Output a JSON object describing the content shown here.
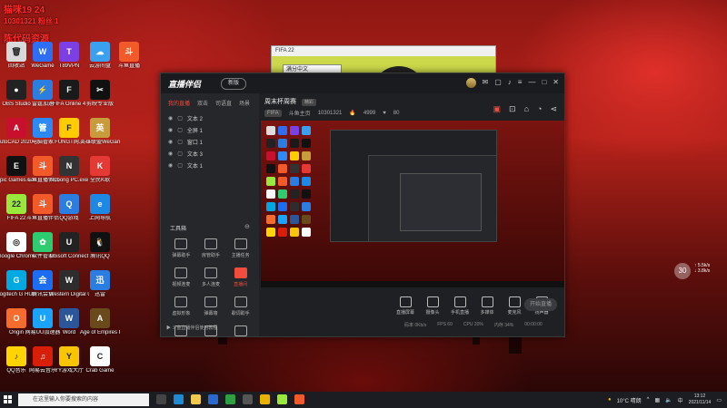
{
  "overlay": {
    "line1": "猫咪19 24",
    "line2": "10301321 粉丝 1",
    "line3": "陈代码资源"
  },
  "desktop_icons": [
    {
      "label": "回收站",
      "color": "#d9d9d9",
      "glyph": "🗑"
    },
    {
      "label": "WeGame",
      "color": "#2e6ef5",
      "glyph": "W"
    },
    {
      "label": "T89VPN",
      "color": "#7b3fe4",
      "glyph": "T"
    },
    {
      "label": "云游间盘",
      "color": "#3aa0f0",
      "glyph": "☁"
    },
    {
      "label": "斗鱼直播",
      "color": "#f25a2a",
      "glyph": "斗"
    },
    {
      "label": "OBS Studio",
      "color": "#222",
      "glyph": "●"
    },
    {
      "label": "雷霆加速",
      "color": "#2a7de1",
      "glyph": "⚡"
    },
    {
      "label": "FIFA Online 4",
      "color": "#1a1a1a",
      "glyph": "F"
    },
    {
      "label": "剪映专业版",
      "color": "#111",
      "glyph": "✂"
    },
    {
      "label": "AutoCAD 2020 - 简...",
      "color": "#c8102e",
      "glyph": "A"
    },
    {
      "label": "电脑管家",
      "color": "#2b8af5",
      "glyph": "管"
    },
    {
      "label": "FUNGT网...",
      "color": "#ffcc00",
      "glyph": "F"
    },
    {
      "label": "英雄联盟WeGame版",
      "color": "#c89b3c",
      "glyph": "英"
    },
    {
      "label": "Epic Games Launcher",
      "color": "#111",
      "glyph": "E"
    },
    {
      "label": "斗鱼直播伴侣",
      "color": "#f25a2a",
      "glyph": "斗"
    },
    {
      "label": "NLoong PC.exe",
      "color": "#333",
      "glyph": "N"
    },
    {
      "label": "全民K歌",
      "color": "#e53935",
      "glyph": "K"
    },
    {
      "label": "FIFA 22",
      "color": "#9be83c",
      "glyph": "22"
    },
    {
      "label": "斗鱼直播伴侣",
      "color": "#f25a2a",
      "glyph": "斗"
    },
    {
      "label": "QQ游戏",
      "color": "#2a7de1",
      "glyph": "Q"
    },
    {
      "label": "上网导航",
      "color": "#1e88e5",
      "glyph": "e"
    },
    {
      "label": "Google Chrome",
      "color": "#fff",
      "glyph": "◎"
    },
    {
      "label": "软件管家",
      "color": "#2ecc71",
      "glyph": "✿"
    },
    {
      "label": "Ubisoft Connect",
      "color": "#222",
      "glyph": "U"
    },
    {
      "label": "腾讯QQ",
      "color": "#111",
      "glyph": "🐧"
    },
    {
      "label": "Logitech G HUB",
      "color": "#00a9e0",
      "glyph": "G"
    },
    {
      "label": "腾讯会议",
      "color": "#1b6ef3",
      "glyph": "会"
    },
    {
      "label": "Western Digital Ut...",
      "color": "#2d2d2d",
      "glyph": "W"
    },
    {
      "label": "迅雷",
      "color": "#2a7de1",
      "glyph": "迅"
    },
    {
      "label": "Origin",
      "color": "#f56c2d",
      "glyph": "O"
    },
    {
      "label": "网易UU加速器",
      "color": "#1aa3ff",
      "glyph": "U"
    },
    {
      "label": "Word",
      "color": "#2b579a",
      "glyph": "W"
    },
    {
      "label": "Age of Empires IV",
      "color": "#6a4a1a",
      "glyph": "A"
    },
    {
      "label": "QQ音乐",
      "color": "#ffd400",
      "glyph": "♪"
    },
    {
      "label": "网易云音乐",
      "color": "#d81e06",
      "glyph": "♫"
    },
    {
      "label": "YY游戏大厅",
      "color": "#f7c600",
      "glyph": "Y"
    },
    {
      "label": "Crab Game",
      "color": "#fff",
      "glyph": "C"
    }
  ],
  "small_window": {
    "title": "FIFA 22",
    "dropdown": "满分中文"
  },
  "app": {
    "logo": "直播伴侣",
    "badge": "新版",
    "tabs": [
      "我的直播",
      "双击",
      "司语直",
      "场景"
    ],
    "scenes": [
      "文本 2",
      "全屏 1",
      "窗口 1",
      "文本 3",
      "文本 1"
    ],
    "tools_title": "工具箱",
    "tools": [
      "弹幕助手",
      "房管助手",
      "主播任务",
      "视频连麦",
      "多人连麦",
      "直播间",
      "虚拟形象",
      "弹幕墙",
      "歌词助手",
      "",
      "",
      ""
    ],
    "tip": "斗鱼直播伴侣使用教程",
    "room_title": "周末杯周赛",
    "room_tag": "精彩",
    "room_game": "FIFA",
    "room_name": "斗鱼主页",
    "room_id": "10301321",
    "heat": "4999",
    "fans": "80",
    "controls": [
      "直播屏幕",
      "摄像头",
      "手机直播",
      "多媒体",
      "麦克风",
      "扬声器"
    ],
    "go_live": "开始直播",
    "stats": [
      "码率 0Kb/s",
      "FPS 60",
      "CPU 20%",
      "内存 34%",
      "00:00:00"
    ]
  },
  "widget": {
    "temp": "30",
    "line1": "↑ 5.5k/s",
    "line2": "↓ 3.8k/s"
  },
  "taskbar": {
    "search_placeholder": "在这里输入你要搜索的内容",
    "weather": "10°C 晴朗",
    "time": "13:12",
    "date": "2021/11/14"
  },
  "colors": {
    "accent": "#f24c3d",
    "app_bg": "#1f2024",
    "panel_bg": "#26272b"
  }
}
